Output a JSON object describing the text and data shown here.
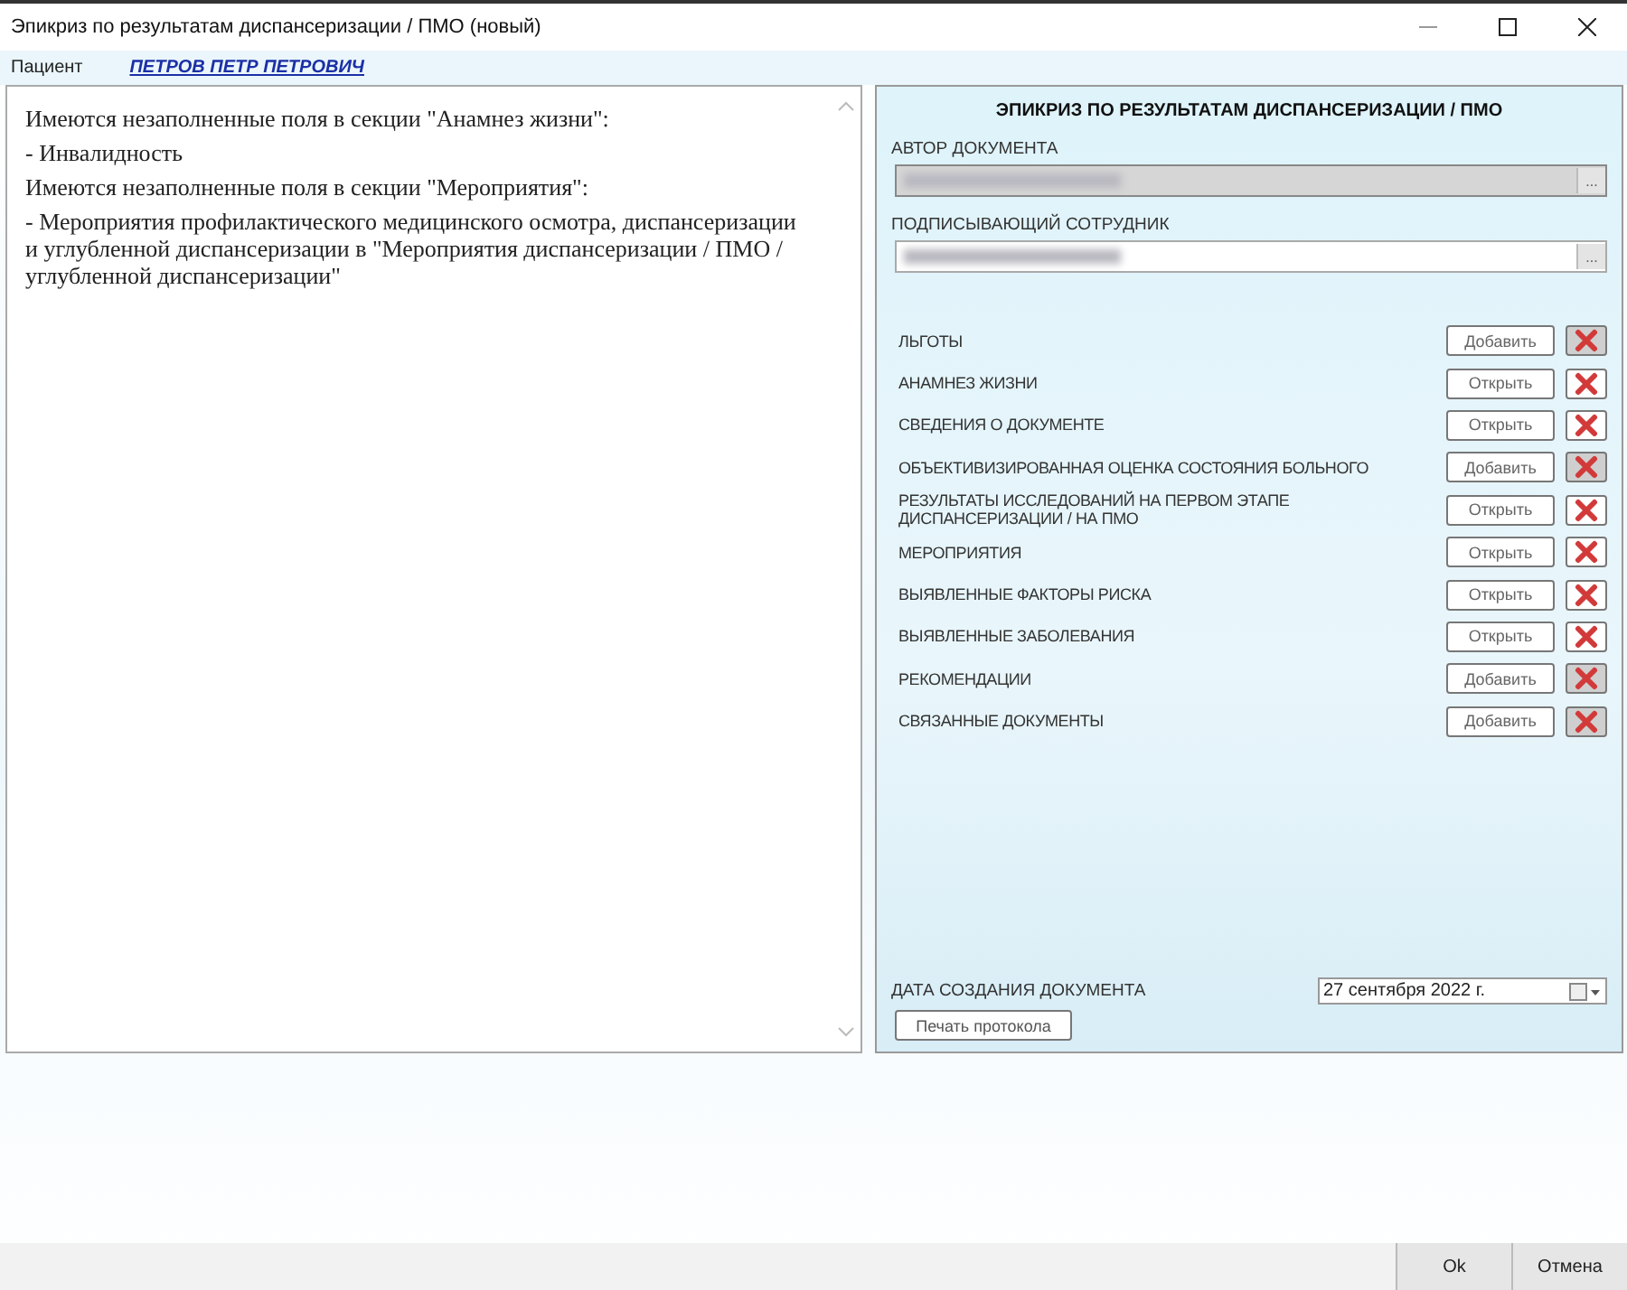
{
  "window": {
    "title": "Эпикриз по результатам диспансеризации / ПМО (новый)"
  },
  "patient": {
    "label": "Пациент",
    "name": "ПЕТРОВ ПЕТР ПЕТРОВИЧ"
  },
  "messages": [
    "Имеются незаполненные поля в секции \"Анамнез жизни\":",
    "- Инвалидность",
    "Имеются незаполненные поля в секции \"Мероприятия\":",
    "- Мероприятия профилактического медицинского осмотра, диспансеризации и углубленной диспансеризации в \"Мероприятия диспансеризации / ПМО / углубленной диспансеризации\""
  ],
  "form": {
    "heading": "ЭПИКРИЗ ПО РЕЗУЛЬТАТАМ ДИСПАНСЕРИЗАЦИИ / ПМО",
    "fields": [
      {
        "label": "АВТОР ДОКУМЕНТА",
        "disabled": true,
        "button": "..."
      },
      {
        "label": "ПОДПИСЫВАЮЩИЙ СОТРУДНИК",
        "disabled": false,
        "button": "..."
      }
    ],
    "sections": [
      {
        "label": "ЛЬГОТЫ",
        "action": "Добавить",
        "delete_disabled": true
      },
      {
        "label": "АНАМНЕЗ ЖИЗНИ",
        "action": "Открыть",
        "delete_disabled": false
      },
      {
        "label": "СВЕДЕНИЯ О ДОКУМЕНТЕ",
        "action": "Открыть",
        "delete_disabled": false
      },
      {
        "label": "ОБЪЕКТИВИЗИРОВАННАЯ ОЦЕНКА СОСТОЯНИЯ БОЛЬНОГО",
        "action": "Добавить",
        "delete_disabled": true
      },
      {
        "label": "РЕЗУЛЬТАТЫ ИССЛЕДОВАНИЙ НА ПЕРВОМ ЭТАПЕ ДИСПАНСЕРИЗАЦИИ / НА ПМО",
        "action": "Открыть",
        "delete_disabled": false
      },
      {
        "label": "МЕРОПРИЯТИЯ",
        "action": "Открыть",
        "delete_disabled": false
      },
      {
        "label": "ВЫЯВЛЕННЫЕ ФАКТОРЫ РИСКА",
        "action": "Открыть",
        "delete_disabled": false
      },
      {
        "label": "ВЫЯВЛЕННЫЕ ЗАБОЛЕВАНИЯ",
        "action": "Открыть",
        "delete_disabled": false
      },
      {
        "label": "РЕКОМЕНДАЦИИ",
        "action": "Добавить",
        "delete_disabled": true
      },
      {
        "label": "СВЯЗАННЫЕ ДОКУМЕНТЫ",
        "action": "Добавить",
        "delete_disabled": true
      }
    ],
    "date_label": "ДАТА СОЗДАНИЯ ДОКУМЕНТА",
    "date_value": "27 сентября 2022 г.",
    "print_button": "Печать протокола"
  },
  "buttons": [
    "Ok",
    "Отмена"
  ]
}
